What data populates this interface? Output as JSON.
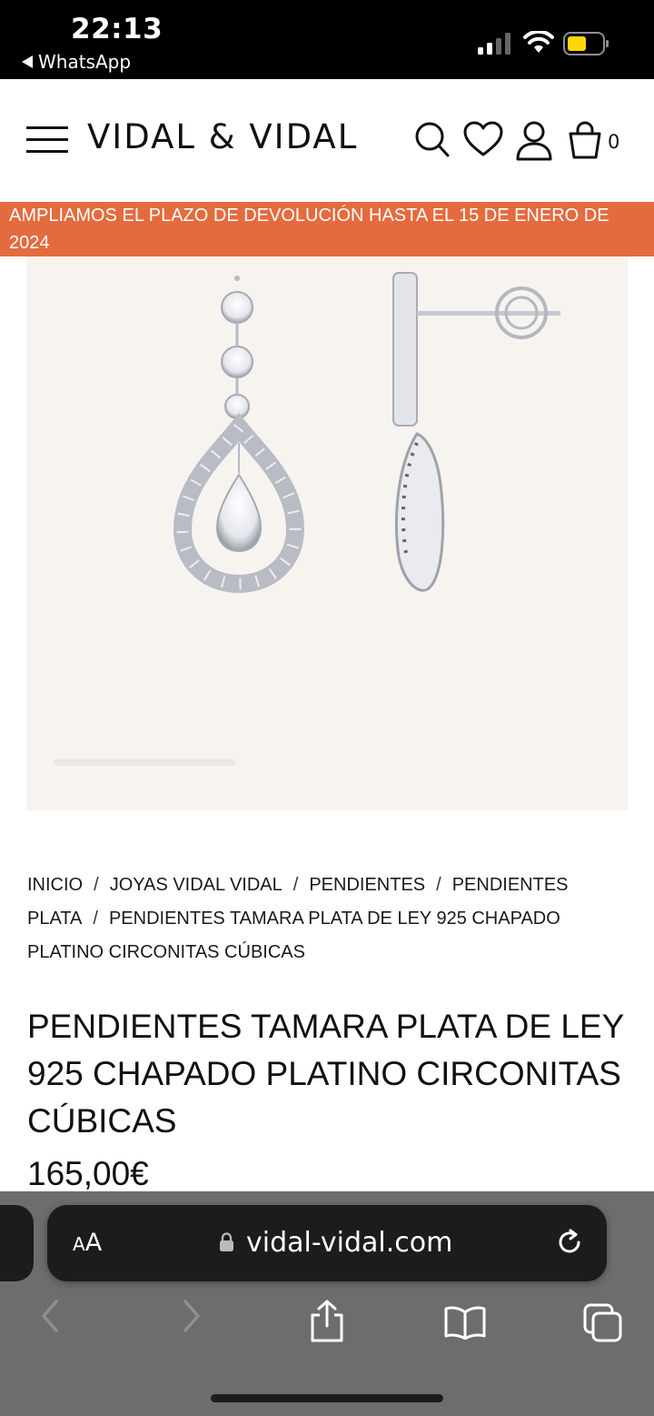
{
  "status_bar": {
    "time": "22:13",
    "back_app": "WhatsApp",
    "battery_color": "#ffd60a"
  },
  "header": {
    "brand": "VIDAL & VIDAL",
    "cart_count": "0",
    "icons": [
      "menu-icon",
      "search-icon",
      "heart-icon",
      "user-icon",
      "cart-icon"
    ]
  },
  "promo_banner": {
    "text": "AMPLIAMOS EL PLAZO DE DEVOLUCIÓN HASTA EL 15 DE ENERO DE 2024",
    "color": "#e46b3e"
  },
  "breadcrumb": {
    "items": [
      "INICIO",
      "JOYAS VIDAL VIDAL",
      "PENDIENTES",
      "PENDIENTES PLATA",
      "PENDIENTES TAMARA PLATA DE LEY 925 CHAPADO PLATINO CIRCONITAS CÚBICAS"
    ],
    "separator": "/"
  },
  "product": {
    "title": "PENDIENTES TAMARA PLATA DE LEY 925 CHAPADO PLATINO CIRCONITAS CÚBICAS",
    "price": "165,00€"
  },
  "browser": {
    "text_size_small": "A",
    "text_size_big": "A",
    "url": "vidal-vidal.com",
    "toolbar_icons": [
      "back-icon",
      "forward-icon",
      "share-icon",
      "bookmarks-icon",
      "tabs-icon"
    ]
  }
}
